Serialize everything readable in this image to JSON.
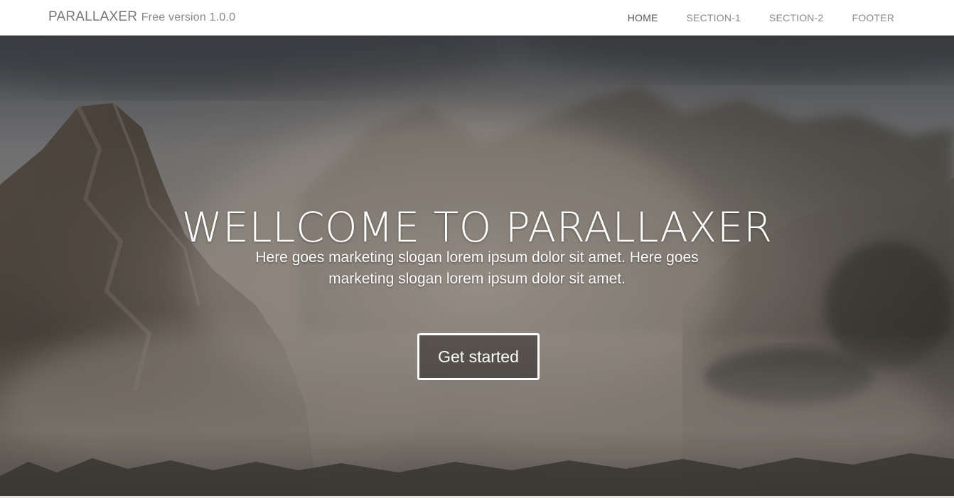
{
  "navbar": {
    "brand_name": "PARALLAXER",
    "brand_version": "Free version 1.0.0",
    "links": [
      {
        "label": "HOME",
        "active": true
      },
      {
        "label": "SECTION-1",
        "active": false
      },
      {
        "label": "SECTION-2",
        "active": false
      },
      {
        "label": "FOOTER",
        "active": false
      }
    ]
  },
  "hero": {
    "title": "WELLCOME TO PARALLAXER",
    "slogan": "Here goes marketing slogan lorem ipsum dolor sit amet. Here goes marketing slogan lorem ipsum dolor sit amet.",
    "cta_label": "Get started",
    "background": "misty-mountain-landscape"
  },
  "colors": {
    "navbar_bg": "#ffffff",
    "nav_text": "#8a8a8a",
    "nav_active_text": "#555555",
    "hero_text": "#ffffff"
  }
}
